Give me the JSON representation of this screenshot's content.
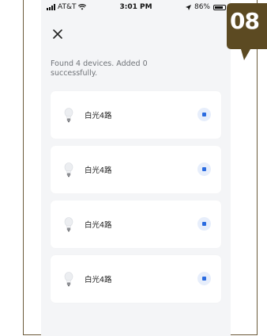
{
  "status_bar": {
    "carrier": "AT&T",
    "time": "3:01 PM",
    "battery": "86%",
    "battery_level": 0.86
  },
  "header": {
    "close_icon": "close-icon"
  },
  "summary": {
    "found_text": "Found 4 devices. Added 0 successfully."
  },
  "devices": [
    {
      "name": "白光4路",
      "icon": "bulb-icon"
    },
    {
      "name": "白光4路",
      "icon": "bulb-icon"
    },
    {
      "name": "白光4路",
      "icon": "bulb-icon"
    },
    {
      "name": "白光4路",
      "icon": "bulb-icon"
    }
  ],
  "step_badge": {
    "label": "08",
    "color": "#5c4a22"
  },
  "colors": {
    "accent": "#2a6be0",
    "background": "#f4f5f7",
    "frame": "#6b5a3a"
  }
}
